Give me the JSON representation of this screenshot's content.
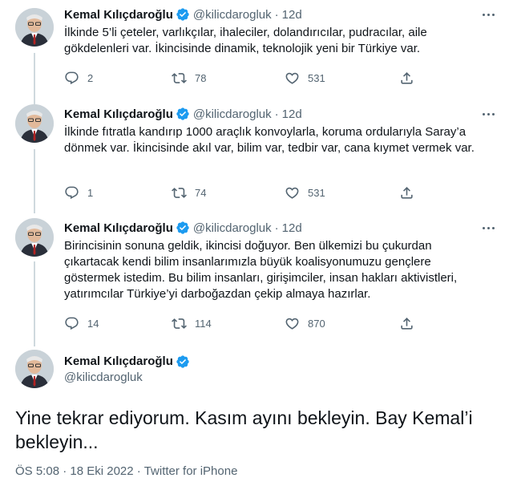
{
  "author": {
    "name": "Kemal Kılıçdaroğlu",
    "handle": "@kilicdarogluk",
    "separator": "·"
  },
  "tweets": [
    {
      "time": "12d",
      "text": "İlkinde 5’li çeteler, varlıkçılar, ihaleciler, dolandırıcılar, pudracılar, aile gökdelenleri var. İkincisinde dinamik, teknolojik yeni bir Türkiye var.",
      "replies": "2",
      "retweets": "78",
      "likes": "531"
    },
    {
      "time": "12d",
      "text": "İlkinde fıtratla kandırıp 1000 araçlık konvoylarla, koruma ordularıyla Saray’a dönmek var. İkincisinde akıl var, bilim var, tedbir var, cana kıymet vermek var.",
      "replies": "1",
      "retweets": "74",
      "likes": "531"
    },
    {
      "time": "12d",
      "text": "Birincisinin sonuna geldik, ikincisi doğuyor. Ben ülkemizi bu çukurdan çıkartacak kendi bilim insanlarımızla büyük koalisyonumuzu gençlere göstermek istedim. Bu bilim insanları, girişimciler, insan hakları aktivistleri, yatırımcılar Türkiye’yi darboğazdan çekip almaya hazırlar.",
      "replies": "14",
      "retweets": "114",
      "likes": "870"
    }
  ],
  "main_tweet": {
    "text": "Yine tekrar ediyorum. Kasım ayını bekleyin. Bay Kemal’i bekleyin...",
    "time": "ÖS 5:08",
    "date": "18 Eki 2022",
    "meta_separator": "·",
    "source": "Twitter for iPhone"
  },
  "icons": {
    "verified": "verified-badge-icon",
    "reply": "reply-icon",
    "retweet": "retweet-icon",
    "like": "heart-icon",
    "share": "share-icon",
    "more": "more-icon"
  },
  "colors": {
    "verified": "#1d9bf0",
    "text": "#0f1419",
    "secondary": "#536471",
    "thread_line": "#cfd9de"
  }
}
